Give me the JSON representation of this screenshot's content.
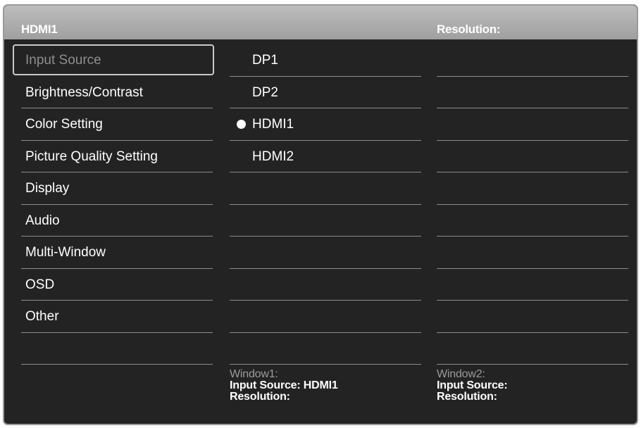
{
  "header": {
    "title": "HDMI1",
    "resolution_label": "Resolution:"
  },
  "menu": {
    "items": [
      {
        "label": "Input Source",
        "selected": true
      },
      {
        "label": "Brightness/Contrast"
      },
      {
        "label": "Color Setting"
      },
      {
        "label": "Picture Quality Setting"
      },
      {
        "label": "Display"
      },
      {
        "label": "Audio"
      },
      {
        "label": "Multi-Window"
      },
      {
        "label": "OSD"
      },
      {
        "label": "Other"
      },
      {
        "label": ""
      }
    ]
  },
  "sources": {
    "items": [
      {
        "label": "DP1"
      },
      {
        "label": "DP2"
      },
      {
        "label": "HDMI1",
        "active": true
      },
      {
        "label": "HDMI2"
      }
    ]
  },
  "window1": {
    "label": "Window1:",
    "input_source": "Input Source: HDMI1",
    "resolution": "Resolution:"
  },
  "window2": {
    "label": "Window2:",
    "input_source": "Input Source:",
    "resolution": "Resolution:"
  },
  "colors": {
    "background": "#232323",
    "header": "#b0b0b0",
    "selected_text": "#8e8e8e",
    "divider": "#8c8c8c"
  }
}
